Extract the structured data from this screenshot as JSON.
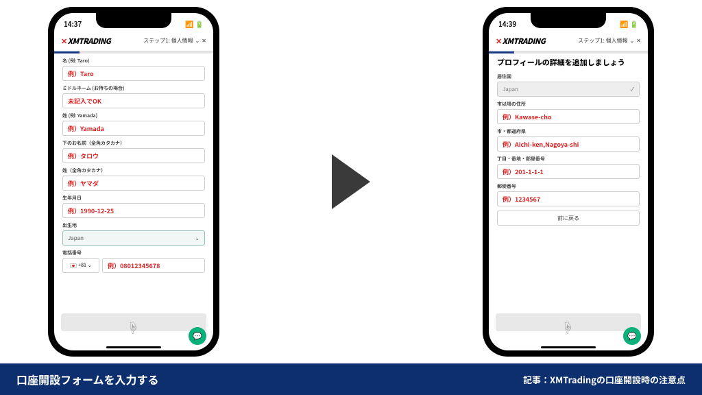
{
  "banner": {
    "left": "口座開設フォームを入力する",
    "right": "記事：XMTradingの口座開設時の注意点"
  },
  "phone1": {
    "time": "14:37",
    "brand": "XMTRADING",
    "step": "ステップ1: 個人情報",
    "fields": {
      "name_label": "名 (例: Taro)",
      "name_val": "例）Taro",
      "mid_label": "ミドルネーム (お持ちの場合)",
      "mid_val": "未記入でOK",
      "last_label": "姓 (例: Yamada)",
      "last_val": "例）Yamada",
      "kana1_label": "下のお名前（全角カタカナ）",
      "kana1_val": "例）タロウ",
      "kana2_label": "姓（全角カタカナ）",
      "kana2_val": "例）ヤマダ",
      "dob_label": "生年月日",
      "dob_val": "例）1990-12-25",
      "birth_label": "出生地",
      "birth_val": "Japan",
      "tel_label": "電話番号",
      "tel_code": "+81",
      "tel_val": "例）08012345678"
    }
  },
  "phone2": {
    "time": "14:39",
    "brand": "XMTRADING",
    "step": "ステップ1: 個人情報",
    "heading": "プロフィールの詳細を追加しましょう",
    "fields": {
      "country_label": "居住国",
      "country_val": "Japan",
      "addr_label": "市以降の住所",
      "addr_val": "例）Kawase-cho",
      "city_label": "市・都道府県",
      "city_val": "例）Aichi-ken,Nagoya-shi",
      "street_label": "丁目・番地・部屋番号",
      "street_val": "例）201-1-1-1",
      "zip_label": "郵便番号",
      "zip_val": "例）1234567",
      "back": "前に戻る"
    }
  }
}
